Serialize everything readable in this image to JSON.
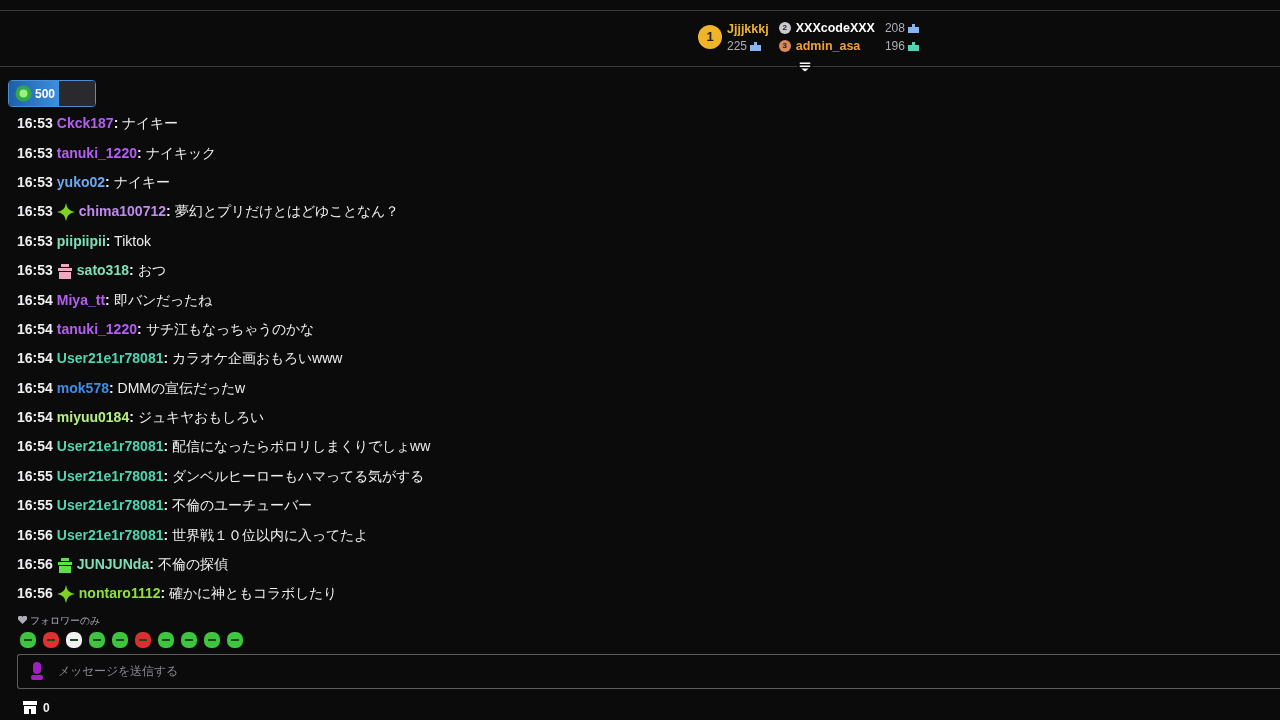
{
  "leaderboard": [
    {
      "rank": "1",
      "name": "Jjjjkkkj",
      "score": "225"
    },
    {
      "rank": "2",
      "name": "XXXcodeXXX",
      "score": "208"
    },
    {
      "rank": "3",
      "name": "admin_asa",
      "score": "196"
    }
  ],
  "points": {
    "value": "500"
  },
  "messages": [
    {
      "time": "16:53",
      "user": "Ckck187",
      "color": "#b45ff0",
      "kind": "plain",
      "text": "**:** ナイキー"
    },
    {
      "time": "16:53",
      "user": "tanuki_1220",
      "color": "#b45ff0",
      "kind": "plain",
      "text": "**:** ナイキック"
    },
    {
      "time": "16:53",
      "user": "yuko02",
      "color": "#6aa9f2",
      "kind": "plain",
      "text": "**:** ナイキー"
    },
    {
      "time": "16:53",
      "user": "chima100712",
      "color": "#c08af0",
      "kind": "sparkle",
      "text": "**:** 夢幻とプリだけとはどゆことなん？"
    },
    {
      "time": "16:53",
      "user": "piipiipii",
      "color": "#7fe0b8",
      "kind": "plain",
      "text": "**:** Tiktok"
    },
    {
      "time": "16:53",
      "user": "sato318",
      "color": "#7fe0b8",
      "kind": "gift-pink",
      "text": "**:** おつ"
    },
    {
      "time": "16:54",
      "user": "Miya_tt",
      "color": "#b45ff0",
      "kind": "plain",
      "text": "**:** 即バンだったね"
    },
    {
      "time": "16:54",
      "user": "tanuki_1220",
      "color": "#b45ff0",
      "kind": "plain",
      "text": "**:** サチ江もなっちゃうのかな"
    },
    {
      "time": "16:54",
      "user": "User21e1r78081",
      "color": "#4fd6b0",
      "kind": "plain",
      "text": "**:** カラオケ企画おもろいwww"
    },
    {
      "time": "16:54",
      "user": "mok578",
      "color": "#3b8ee8",
      "kind": "plain",
      "text": "**:** DMMの宣伝だったw"
    },
    {
      "time": "16:54",
      "user": "miyuu0184",
      "color": "#b8f080",
      "kind": "plain",
      "text": "**:** ジュキヤおもしろい"
    },
    {
      "time": "16:54",
      "user": "User21e1r78081",
      "color": "#4fd6b0",
      "kind": "plain",
      "text": "**:** 配信になったらポロリしまくりでしょww"
    },
    {
      "time": "16:55",
      "user": "User21e1r78081",
      "color": "#4fd6b0",
      "kind": "plain",
      "text": "**:** ダンベルヒーローもハマってる気がする"
    },
    {
      "time": "16:55",
      "user": "User21e1r78081",
      "color": "#4fd6b0",
      "kind": "plain",
      "text": "**:** 不倫のユーチューバー"
    },
    {
      "time": "16:56",
      "user": "User21e1r78081",
      "color": "#4fd6b0",
      "kind": "plain",
      "text": "**:** 世界戦１０位以内に入ってたよ"
    },
    {
      "time": "16:56",
      "user": "JUNJUNda",
      "color": "#7fe0b8",
      "kind": "gift-green",
      "text": "**:** 不倫の探偵"
    },
    {
      "time": "16:56",
      "user": "nontaro1112",
      "color": "#8fe03a",
      "kind": "sparkle",
      "text": "**:** 確かに神ともコラボしたり"
    }
  ],
  "follower_note": "フォロワーのみ",
  "input": {
    "placeholder": "メッセージを送信する"
  },
  "store": {
    "count": "0"
  }
}
